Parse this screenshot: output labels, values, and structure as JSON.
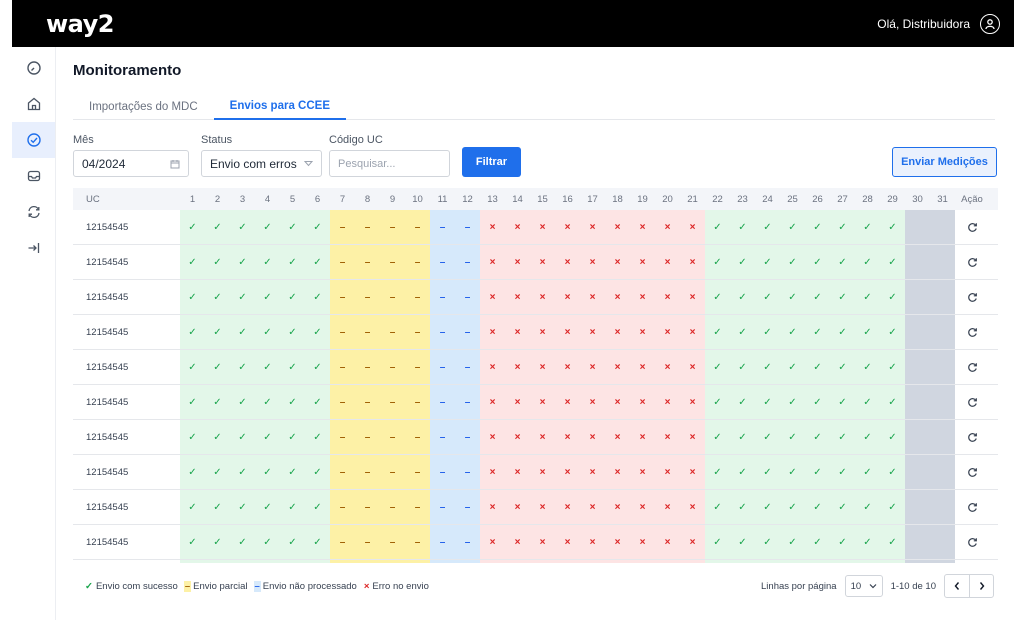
{
  "app": {
    "logo": "way2",
    "greeting": "Olá, Distribuidora",
    "avatar_icon": "user-circle-icon"
  },
  "sidebar": {
    "items": [
      {
        "name": "dashboard",
        "icon": "gauge-icon",
        "active": false
      },
      {
        "name": "home",
        "icon": "home-icon",
        "active": false
      },
      {
        "name": "monitoring",
        "icon": "check-circle-icon",
        "active": true
      },
      {
        "name": "inbox",
        "icon": "inbox-icon",
        "active": false
      },
      {
        "name": "sync",
        "icon": "refresh-icon",
        "active": false
      },
      {
        "name": "logout",
        "icon": "logout-icon",
        "active": false
      }
    ]
  },
  "page": {
    "title": "Monitoramento"
  },
  "tabs": [
    {
      "label": "Importações do MDC",
      "active": false
    },
    {
      "label": "Envios para CCEE",
      "active": true
    }
  ],
  "filters": {
    "month_label": "Mês",
    "month_value": "04/2024",
    "status_label": "Status",
    "status_value": "Envio com erros",
    "uc_label": "Código UC",
    "uc_placeholder": "Pesquisar...",
    "filter_button": "Filtrar",
    "send_button": "Enviar Medições"
  },
  "table": {
    "uc_header": "UC",
    "action_header": "Ação",
    "days": [
      "1",
      "2",
      "3",
      "4",
      "5",
      "6",
      "7",
      "8",
      "9",
      "10",
      "11",
      "12",
      "13",
      "14",
      "15",
      "16",
      "17",
      "18",
      "19",
      "20",
      "21",
      "22",
      "23",
      "24",
      "25",
      "26",
      "27",
      "28",
      "29",
      "30",
      "31"
    ],
    "day_status": [
      "ok",
      "ok",
      "ok",
      "ok",
      "ok",
      "ok",
      "partial",
      "partial",
      "partial",
      "partial",
      "np",
      "np",
      "err",
      "err",
      "err",
      "err",
      "err",
      "err",
      "err",
      "err",
      "err",
      "ok",
      "ok",
      "ok",
      "ok",
      "ok",
      "ok",
      "ok",
      "ok",
      "none",
      "none"
    ],
    "symbols": {
      "ok": "✓",
      "partial": "–",
      "np": "–",
      "err": "×",
      "none": ""
    },
    "rows": [
      "12154545",
      "12154545",
      "12154545",
      "12154545",
      "12154545",
      "12154545",
      "12154545",
      "12154545",
      "12154545",
      "12154545"
    ],
    "action_icon": "resend-icon"
  },
  "legend": [
    {
      "symbol": "✓",
      "label": "Envio com sucesso",
      "status": "ok"
    },
    {
      "symbol": "–",
      "label": "Envio parcial",
      "status": "partial"
    },
    {
      "symbol": "–",
      "label": "Envio não processado",
      "status": "np"
    },
    {
      "symbol": "×",
      "label": "Erro no envio",
      "status": "err"
    }
  ],
  "pagination": {
    "rows_per_page_label": "Linhas por página",
    "rows_per_page_value": "10",
    "range": "1-10 de 10"
  },
  "colors": {
    "ok_bg": "#e3f7e9",
    "partial_bg": "#fdf1a6",
    "np_bg": "#d6e9fb",
    "err_bg": "#fde4e4",
    "none_bg": "#d0d6e0",
    "accent": "#1f6feb"
  }
}
